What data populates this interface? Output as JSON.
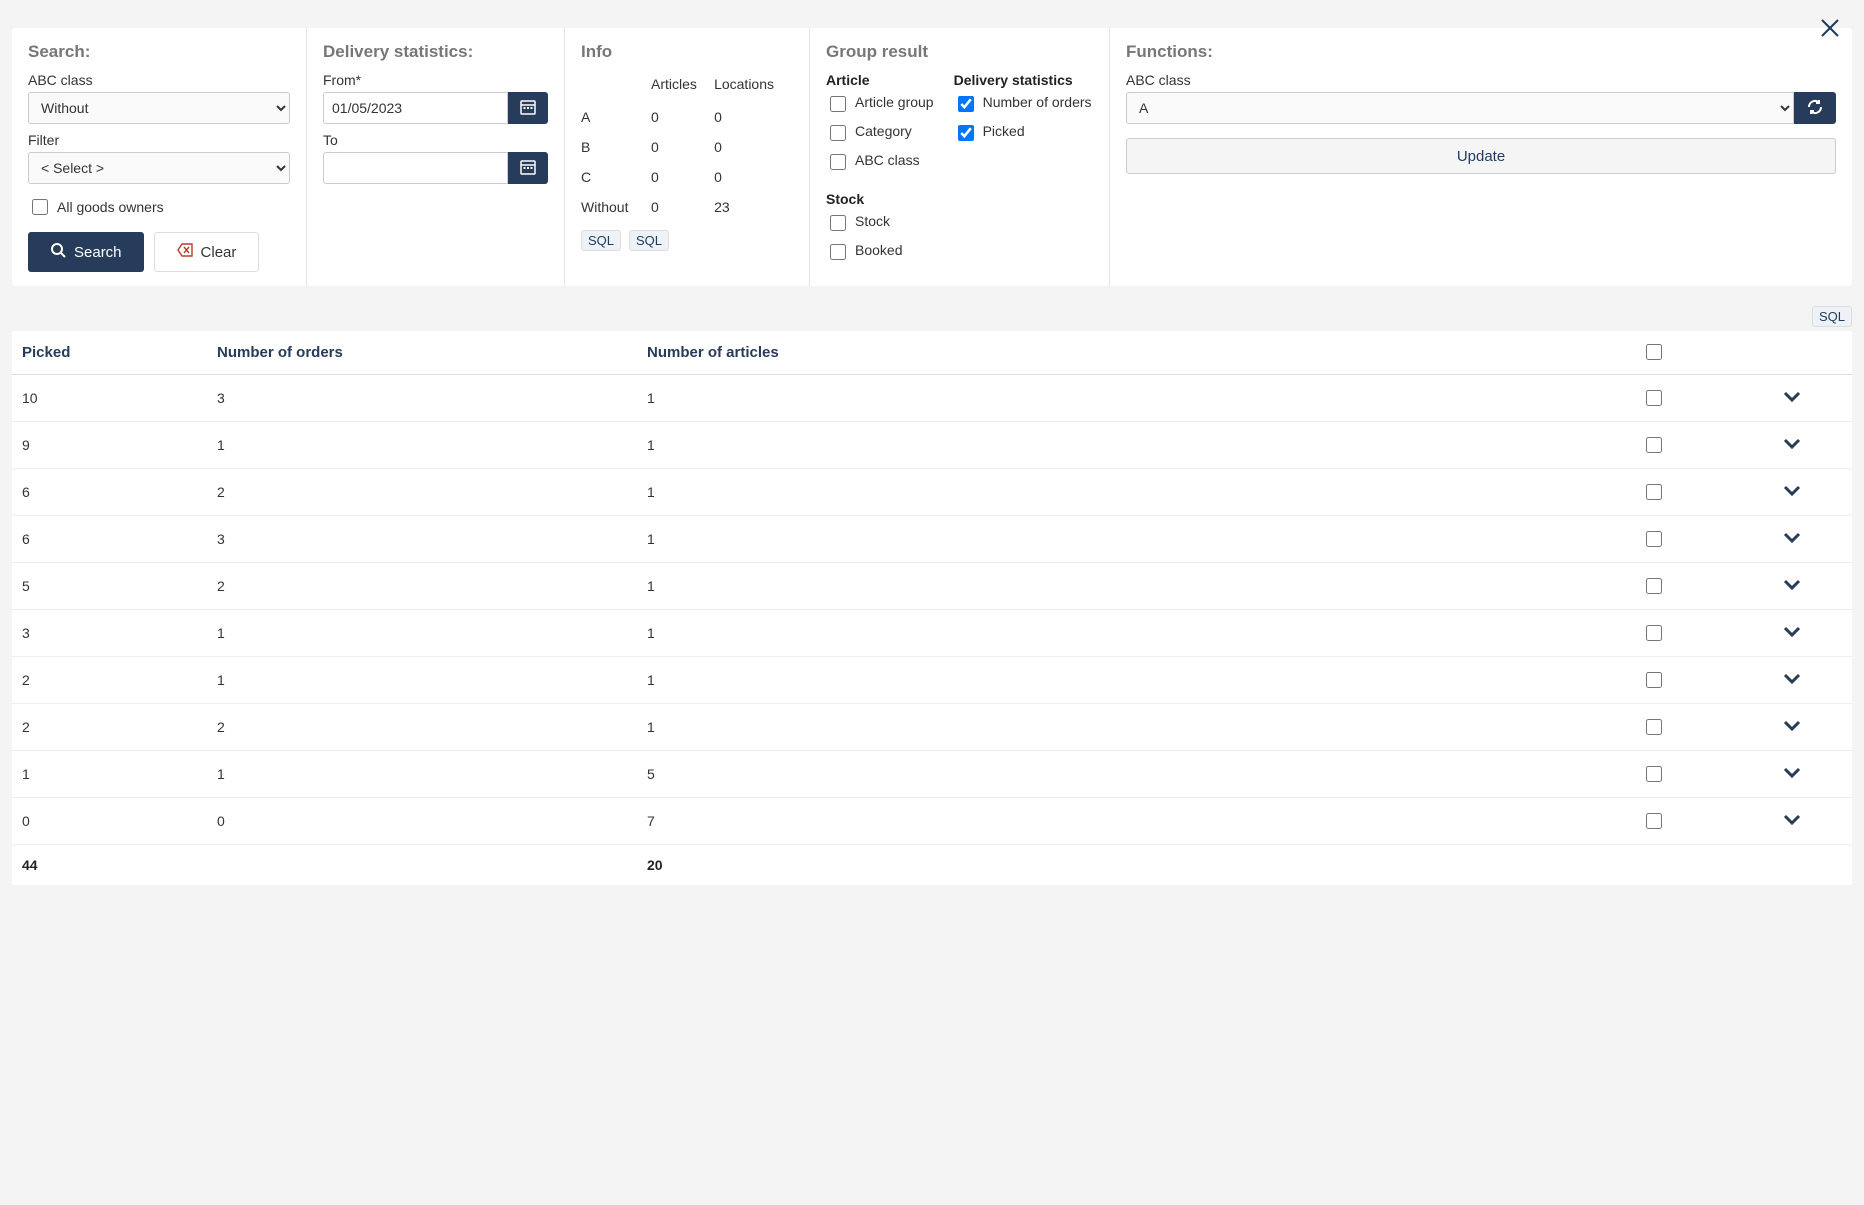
{
  "search": {
    "title": "Search:",
    "abc_class_label": "ABC class",
    "abc_class_options": [
      "Without"
    ],
    "abc_class_selected": "Without",
    "filter_label": "Filter",
    "filter_options": [
      "< Select >"
    ],
    "filter_selected": "< Select >",
    "all_goods_label": "All goods owners",
    "all_goods_checked": false,
    "search_label": "Search",
    "clear_label": "Clear"
  },
  "delivery": {
    "title": "Delivery statistics:",
    "from_label": "From*",
    "from_value": "01/05/2023",
    "to_label": "To",
    "to_value": ""
  },
  "info": {
    "title": "Info",
    "col_articles": "Articles",
    "col_locations": "Locations",
    "rows": [
      {
        "label": "A",
        "articles": "0",
        "locations": "0"
      },
      {
        "label": "B",
        "articles": "0",
        "locations": "0"
      },
      {
        "label": "C",
        "articles": "0",
        "locations": "0"
      },
      {
        "label": "Without",
        "articles": "0",
        "locations": "23"
      }
    ],
    "sql1": "SQL",
    "sql2": "SQL"
  },
  "group": {
    "title": "Group result",
    "article_head": "Article",
    "article_items": [
      {
        "label": "Article group",
        "checked": false
      },
      {
        "label": "Category",
        "checked": false
      },
      {
        "label": "ABC class",
        "checked": false
      }
    ],
    "stock_head": "Stock",
    "stock_items": [
      {
        "label": "Stock",
        "checked": false
      },
      {
        "label": "Booked",
        "checked": false
      }
    ],
    "delivery_head": "Delivery statistics",
    "delivery_items": [
      {
        "label": "Number of orders",
        "checked": true
      },
      {
        "label": "Picked",
        "checked": true
      }
    ]
  },
  "functions": {
    "title": "Functions:",
    "abc_class_label": "ABC class",
    "abc_options": [
      "A"
    ],
    "abc_selected": "A",
    "update_label": "Update"
  },
  "results": {
    "sql_label": "SQL",
    "columns": {
      "picked": "Picked",
      "orders": "Number of orders",
      "articles": "Number of articles"
    },
    "rows": [
      {
        "picked": "10",
        "orders": "3",
        "articles": "1"
      },
      {
        "picked": "9",
        "orders": "1",
        "articles": "1"
      },
      {
        "picked": "6",
        "orders": "2",
        "articles": "1"
      },
      {
        "picked": "6",
        "orders": "3",
        "articles": "1"
      },
      {
        "picked": "5",
        "orders": "2",
        "articles": "1"
      },
      {
        "picked": "3",
        "orders": "1",
        "articles": "1"
      },
      {
        "picked": "2",
        "orders": "1",
        "articles": "1"
      },
      {
        "picked": "2",
        "orders": "2",
        "articles": "1"
      },
      {
        "picked": "1",
        "orders": "1",
        "articles": "5"
      },
      {
        "picked": "0",
        "orders": "0",
        "articles": "7"
      }
    ],
    "totals": {
      "picked": "44",
      "articles": "20"
    }
  }
}
